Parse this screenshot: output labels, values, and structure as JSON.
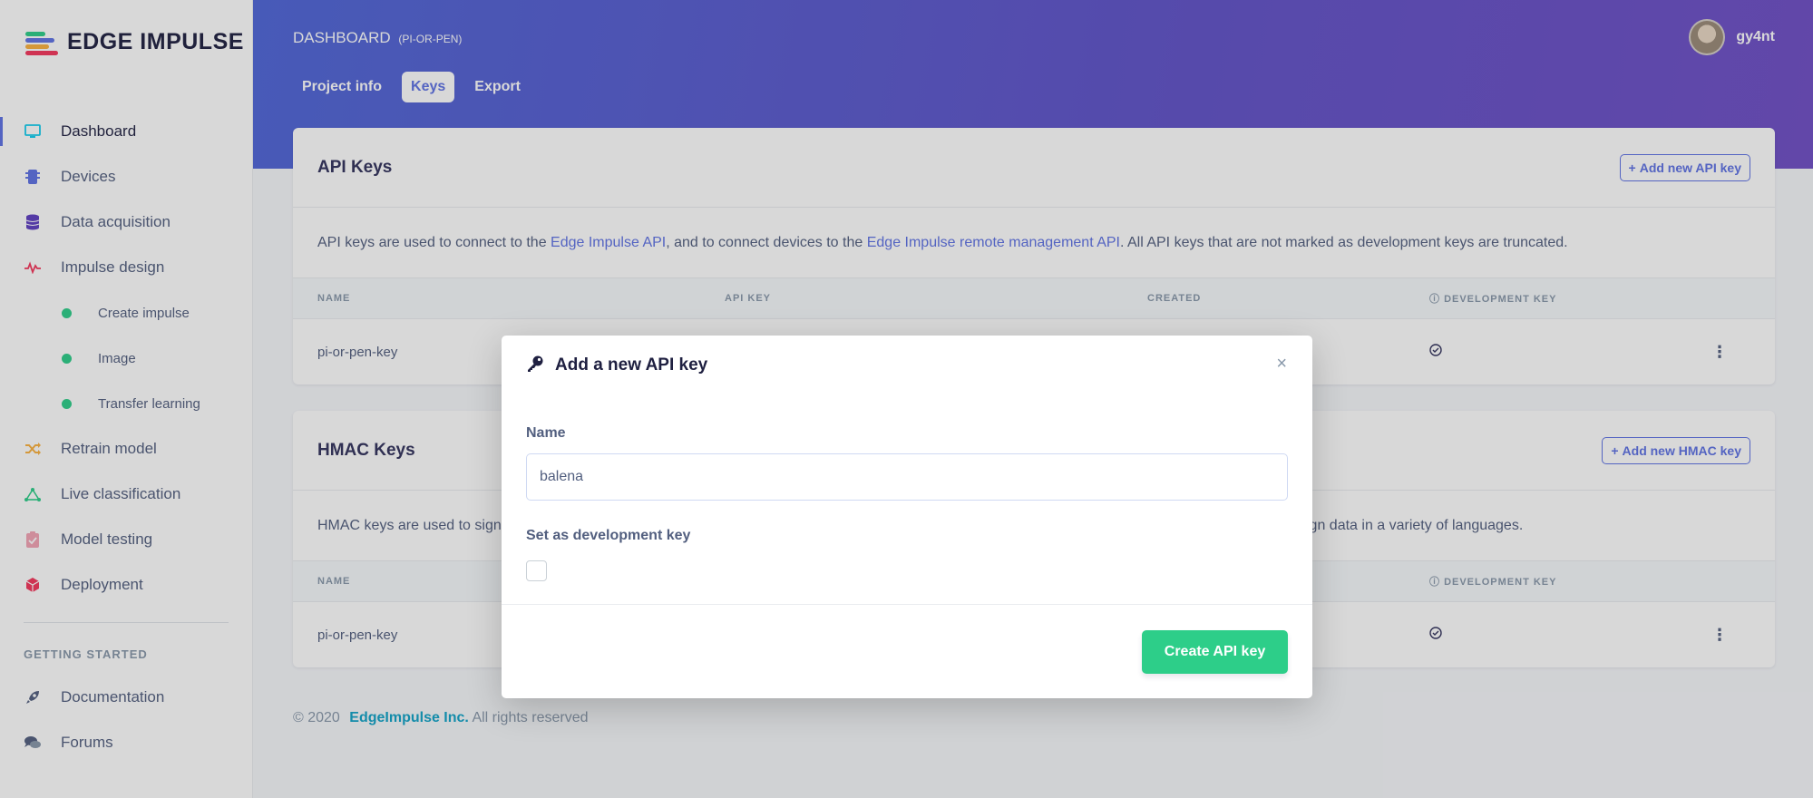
{
  "brand": {
    "name": "EDGE IMPULSE"
  },
  "sidebar": {
    "items": [
      {
        "label": "Dashboard",
        "icon": "monitor-icon",
        "color": "#11cdef"
      },
      {
        "label": "Devices",
        "icon": "chip-icon",
        "color": "#5e72e4"
      },
      {
        "label": "Data acquisition",
        "icon": "database-icon",
        "color": "#5e3fc1"
      },
      {
        "label": "Impulse design",
        "icon": "pulse-icon",
        "color": "#f5365c"
      }
    ],
    "subitems": [
      {
        "label": "Create impulse"
      },
      {
        "label": "Image"
      },
      {
        "label": "Transfer learning"
      }
    ],
    "items2": [
      {
        "label": "Retrain model",
        "icon": "shuffle-icon",
        "color": "#fbb140"
      },
      {
        "label": "Live classification",
        "icon": "graph-icon",
        "color": "#2dce89"
      },
      {
        "label": "Model testing",
        "icon": "clipboard-check-icon",
        "color": "#f3a4b5"
      },
      {
        "label": "Deployment",
        "icon": "cube-icon",
        "color": "#f5365c"
      }
    ],
    "getting_started_heading": "GETTING STARTED",
    "bottom_items": [
      {
        "label": "Documentation",
        "icon": "rocket-icon"
      },
      {
        "label": "Forums",
        "icon": "comments-icon"
      }
    ]
  },
  "header": {
    "title": "DASHBOARD",
    "project": "(PI-OR-PEN)",
    "tabs": [
      {
        "label": "Project info"
      },
      {
        "label": "Keys"
      },
      {
        "label": "Export"
      }
    ],
    "username": "gy4nt"
  },
  "api_keys": {
    "title": "API Keys",
    "add_button": "Add new API key",
    "desc_1": "API keys are used to connect to the ",
    "link_1": "Edge Impulse API",
    "desc_2": ", and to connect devices to the ",
    "link_2": "Edge Impulse remote management API",
    "desc_3": ". All API keys that are not marked as development keys are truncated.",
    "columns": {
      "name": "NAME",
      "key": "API KEY",
      "created": "CREATED",
      "dev": "DEVELOPMENT KEY"
    },
    "rows": [
      {
        "name": "pi-or-pen-key"
      }
    ]
  },
  "hmac_keys": {
    "title": "HMAC Keys",
    "add_button": "Add new HMAC key",
    "desc_start": "HMAC keys are used to sign",
    "desc_end": "ign data in a variety of languages.",
    "columns": {
      "name": "NAME",
      "dev": "DEVELOPMENT KEY"
    },
    "rows": [
      {
        "name": "pi-or-pen-key"
      }
    ]
  },
  "footer": {
    "copyright": "© 2020",
    "company": "EdgeImpulse Inc.",
    "rights": "All rights reserved"
  },
  "modal": {
    "title": "Add a new API key",
    "close": "×",
    "name_label": "Name",
    "name_value": "balena",
    "dev_label": "Set as development key",
    "dev_checked": false,
    "submit": "Create API key"
  }
}
